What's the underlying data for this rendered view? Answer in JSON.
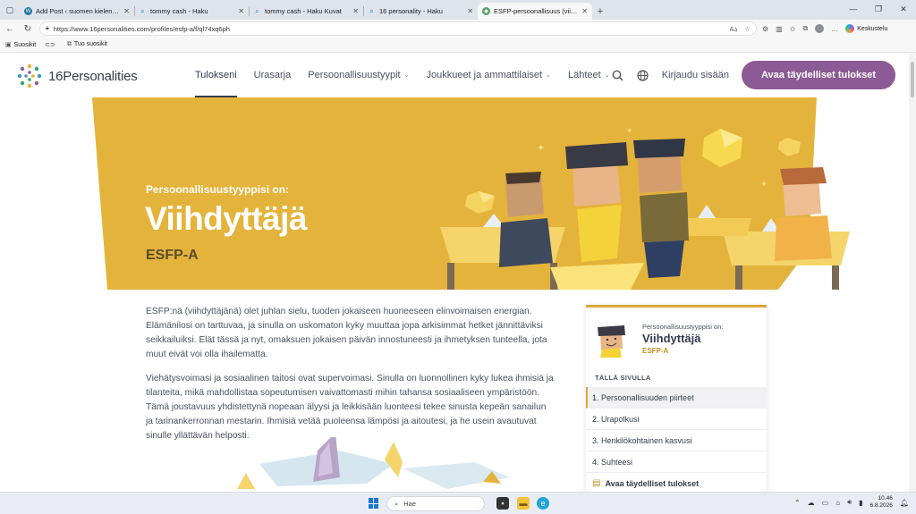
{
  "browser": {
    "tabs": [
      {
        "title": "Add Post ‹ suomen kielen kaksi kasvoa",
        "favicon": "wordpress-icon",
        "active": false
      },
      {
        "title": "tommy cash - Haku",
        "favicon": "search-icon",
        "active": false
      },
      {
        "title": "tommy cash - Haku Kuvat",
        "favicon": "search-icon",
        "active": false
      },
      {
        "title": "16 personality - Haku",
        "favicon": "search-icon",
        "active": false
      },
      {
        "title": "ESFP-persoonallisuus (viihdyttäjä)",
        "favicon": "16p-icon",
        "active": true
      }
    ],
    "url": "https://www.16personalities.com/profiles/esfp-a/f/ql74xq6ph",
    "keskustelu": "Keskustelu",
    "favorites": [
      {
        "label": "Suosikit",
        "icon": "favorites-icon"
      },
      {
        "label": "",
        "icon": "collections-icon"
      },
      {
        "label": "Tuo suosikit",
        "icon": "import-icon"
      }
    ]
  },
  "site": {
    "logo": "16Personalities",
    "nav": [
      {
        "label": "Tulokseni",
        "active": true,
        "dropdown": false
      },
      {
        "label": "Urasarja",
        "active": false,
        "dropdown": false
      },
      {
        "label": "Persoonallisuustyypit",
        "active": false,
        "dropdown": true
      },
      {
        "label": "Joukkueet ja ammattilaiset",
        "active": false,
        "dropdown": true
      },
      {
        "label": "Lähteet",
        "active": false,
        "dropdown": true
      }
    ],
    "login": "Kirjaudu sisään",
    "cta": "Avaa täydelliset tulokset"
  },
  "hero": {
    "subtitle": "Persoonallisuustyyppisi on:",
    "title": "Viihdyttäjä",
    "code": "ESFP-A",
    "bg_color": "#e4b33b"
  },
  "body": {
    "p1": "ESFP:nä (viihdyttäjänä) olet juhlan sielu, tuoden jokaiseen huoneeseen elinvoimaisen energian. Elämänilosi on tarttuvaa, ja sinulla on uskomaton kyky muuttaa jopa arkisimmat hetket jännittäviksi seikkailuiksi. Elät tässä ja nyt, omaksuen jokaisen päivän innostuneesti ja ihmetyksen tunteella, jota muut eivät voi olla ihailematta.",
    "p2": "Viehätysvoimasi ja sosiaalinen taitosi ovat supervoimasi. Sinulla on luonnollinen kyky lukea ihmisiä ja tilanteita, mikä mahdollistaa sopeutumisen vaivattomasti mihin tahansa sosiaaliseen ympäristöön. Tämä joustavuus yhdistettynä nopeaan älyysi ja leikkisään luonteesi tekee sinusta kepeän sanailun ja tarinankerronnan mestarin. Ihmisiä vetää puoleensa lämpösi ja aitoutesi, ja he usein avautuvat sinulle yllättävän helposti."
  },
  "sidecard": {
    "label": "Persoonallisuustyyppisi on:",
    "title": "Viihdyttäjä",
    "code": "ESFP-A",
    "section": "TÄLLÄ SIVULLA",
    "items": [
      "1. Persoonallisuuden piirteet",
      "2. Urapolkusi",
      "3. Henkilökohtainen kasvusi",
      "4. Suhteesi",
      "Avaa täydelliset tulokset"
    ]
  },
  "taskbar": {
    "search": "Hae",
    "time": "10.46",
    "date": "6.8.2026"
  }
}
